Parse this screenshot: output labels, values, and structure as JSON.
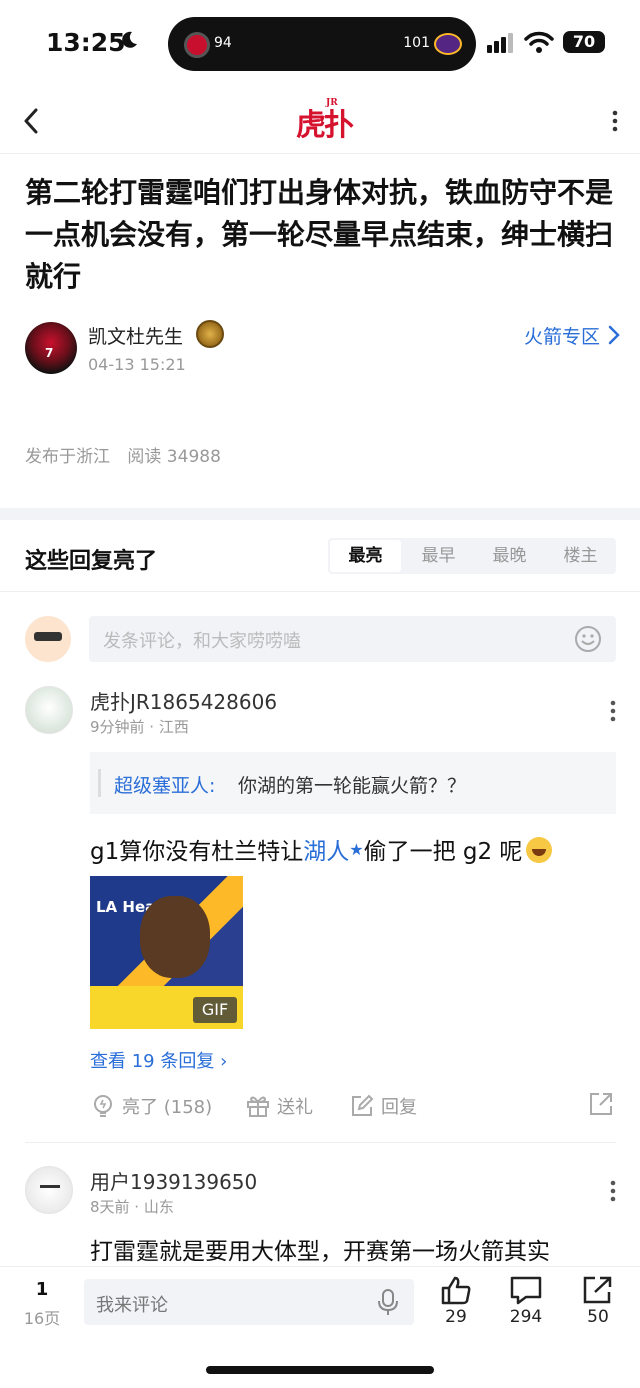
{
  "status_bar": {
    "time": "13:25",
    "score_left": "94",
    "score_right": "101",
    "battery": "70"
  },
  "nav": {
    "logo": "虎扑",
    "logo_sup": "JR"
  },
  "post": {
    "title": "第二轮打雷霆咱们打出身体对抗，铁血防守不是一点机会没有，第一轮尽量早点结束，绅士横扫就行",
    "author": "凯文杜先生",
    "time": "04-13 15:21",
    "zone_link": "火箭专区",
    "location": "发布于浙江",
    "reads": "阅读 34988"
  },
  "replies": {
    "title": "这些回复亮了",
    "tabs": [
      "最亮",
      "最早",
      "最晚",
      "楼主"
    ],
    "compose_placeholder": "发条评论，和大家唠唠嗑"
  },
  "comments": [
    {
      "user": "虎扑JR1865428606",
      "time": "9分钟前 · 江西",
      "quote_user": "超级塞亚人:",
      "quote_text": "你湖的第一轮能赢火箭？？",
      "text_before": "g1算你没有杜兰特让",
      "text_link": "湖人",
      "text_after": "偷了一把 g2 呢",
      "gif_label": "GIF",
      "gif_caption": "LA Health",
      "view_replies": "查看 19 条回复",
      "actions": {
        "light": "亮了 (158)",
        "gift": "送礼",
        "reply": "回复"
      }
    },
    {
      "user": "用户1939139650",
      "time": "8天前 · 山东",
      "text": "打雷霆就是要用大体型，开赛第一场火箭其实"
    }
  ],
  "bottom_bar": {
    "page": "1",
    "pages": "16页",
    "comment_placeholder": "我来评论",
    "likes": "29",
    "comments": "294",
    "shares": "50"
  },
  "colors": {
    "brand_red": "#d6132f",
    "link_blue": "#2a6ed8"
  }
}
